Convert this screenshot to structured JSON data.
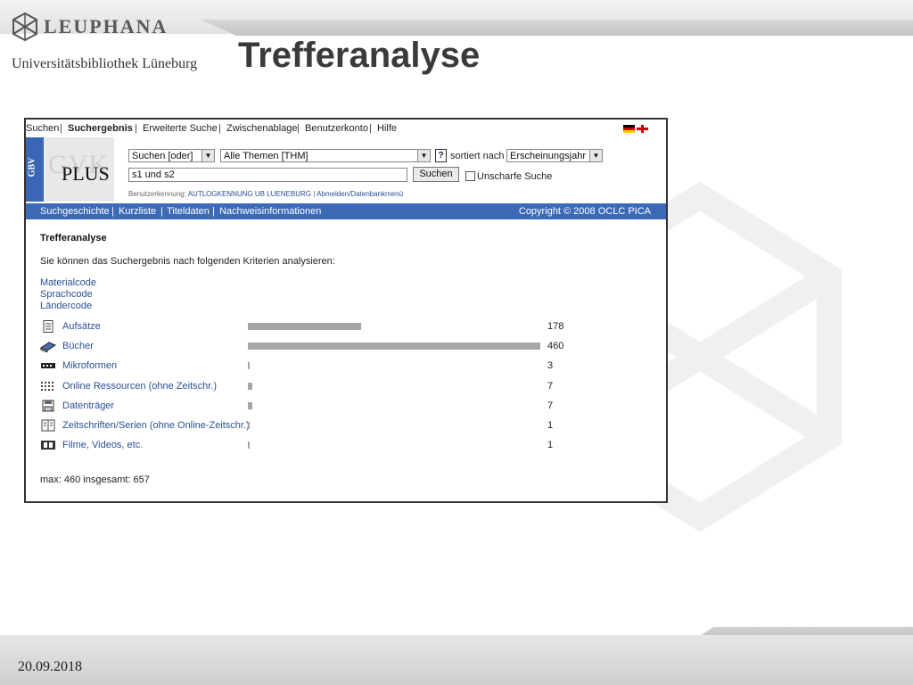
{
  "slide": {
    "logo_text": "LEUPHANA",
    "logo_subtitle": "Universitätsbibliothek Lüneburg",
    "title": "Trefferanalyse",
    "date": "20.09.2018"
  },
  "topnav": {
    "items": [
      "Suchen",
      "Suchergebnis",
      "Erweiterte Suche",
      "Zwischenablage",
      "Benutzerkonto",
      "Hilfe"
    ],
    "active_index": 1
  },
  "logo_widget": {
    "gbv": "GBV",
    "gvk": "GVK",
    "plus": "PLUS"
  },
  "search": {
    "mode_select": "Suchen [oder]",
    "themes_select": "Alle Themen [THM]",
    "help_label": "?",
    "sorted_label": "sortiert nach",
    "sort_select": "Erscheinungsjahr",
    "query_value": "s1 und s2",
    "search_button": "Suchen",
    "fuzzy_label": "Unscharfe Suche",
    "login_label": "Benutzerkennung:",
    "login_user": "AUTLOGKENNUNG UB LUENEBURG",
    "login_sep": "|",
    "login_logout": "Abmelden/Datenbankmenü"
  },
  "bluebar": {
    "items": [
      "Suchgeschichte",
      "Kurzliste",
      "Titeldaten",
      "Nachweisinformationen"
    ],
    "copyright": "Copyright © 2008 OCLC PICA"
  },
  "content": {
    "title": "Trefferanalyse",
    "intro": "Sie können das Suchergebnis nach folgenden Kriterien analysieren:",
    "code_links": [
      "Materialcode",
      "Sprachcode",
      "Ländercode"
    ],
    "max": 460,
    "rows": [
      {
        "icon": "article-icon",
        "label": "Aufsätze",
        "count": 178
      },
      {
        "icon": "book-icon",
        "label": "Bücher",
        "count": 460
      },
      {
        "icon": "microform-icon",
        "label": "Mikroformen",
        "count": 3
      },
      {
        "icon": "online-resource-icon",
        "label": "Online Ressourcen (ohne Zeitschr.)",
        "count": 7
      },
      {
        "icon": "disk-icon",
        "label": "Datenträger",
        "count": 7
      },
      {
        "icon": "journal-icon",
        "label": "Zeitschriften/Serien (ohne Online-Zeitschr.)",
        "count": 1
      },
      {
        "icon": "film-icon",
        "label": "Filme, Videos, etc.",
        "count": 1
      }
    ],
    "summary": "max: 460 insgesamt: 657"
  }
}
